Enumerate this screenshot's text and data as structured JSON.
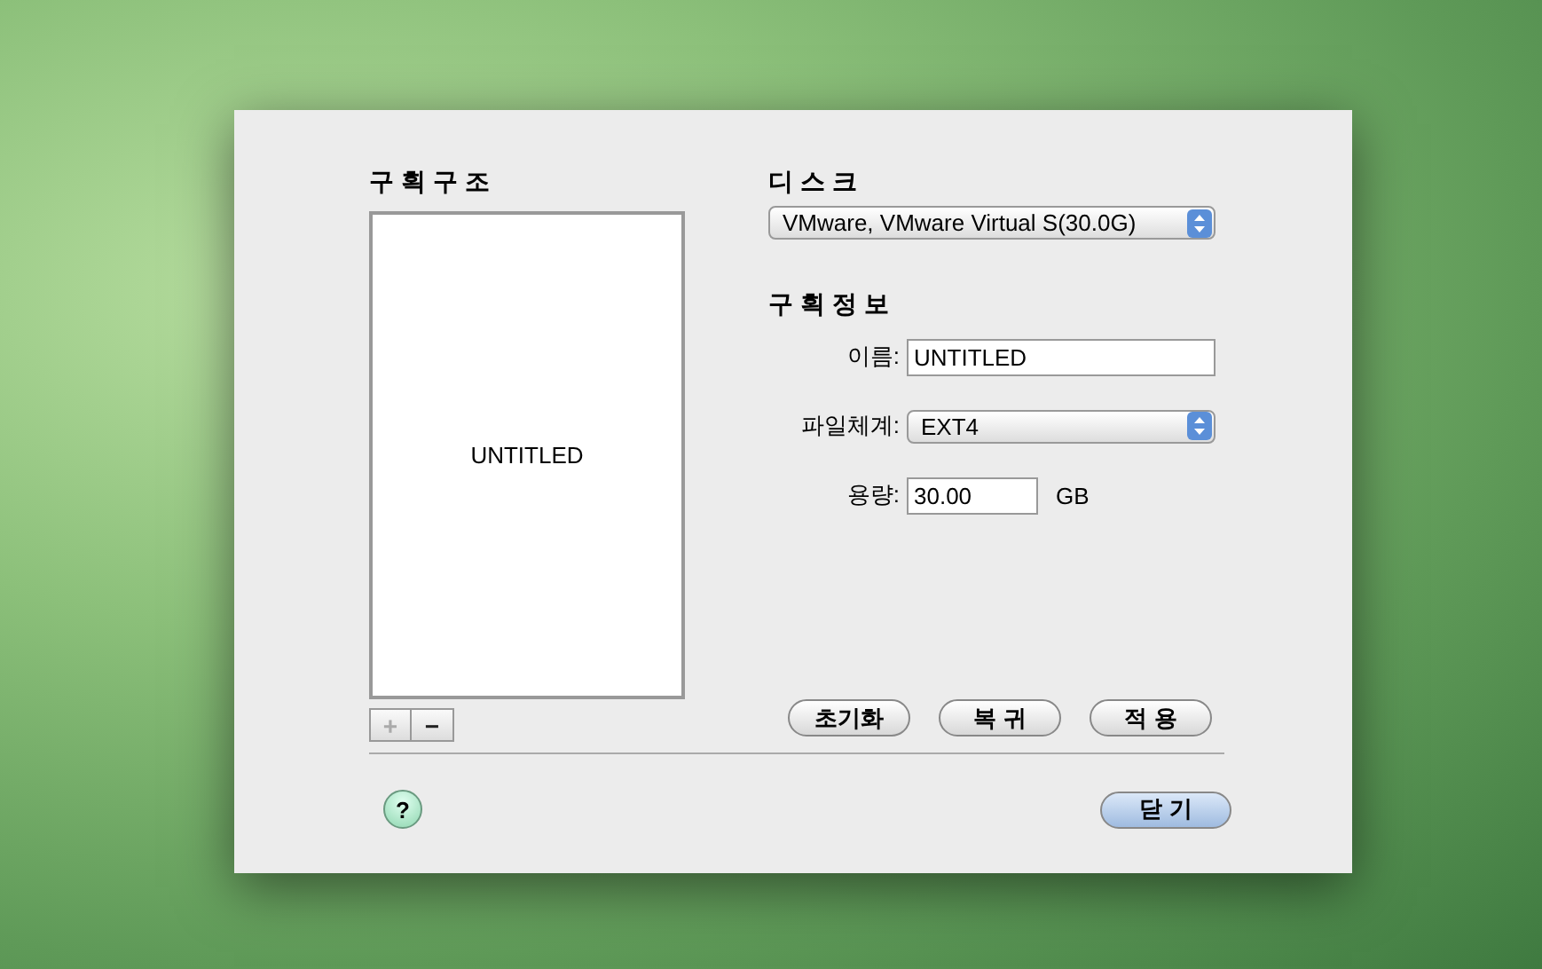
{
  "partition_layout": {
    "title": "구획구조",
    "partitions": [
      {
        "name": "UNTITLED",
        "selected": false
      }
    ],
    "add_button": {
      "label": "+",
      "disabled": true
    },
    "remove_button": {
      "label": "−",
      "disabled": false
    }
  },
  "disk": {
    "title": "디스크",
    "value": "VMware, VMware Virtual S(30.0G)"
  },
  "partition_info": {
    "title": "구획정보",
    "fields": [
      {
        "kind": "text",
        "label": "이름:",
        "value": "UNTITLED"
      },
      {
        "kind": "select",
        "label": "파일체계:",
        "value": "EXT4"
      },
      {
        "kind": "number",
        "label": "용량:",
        "value": "30.00",
        "unit": "GB"
      }
    ],
    "buttons": [
      "초기화",
      "복 귀",
      "적 용"
    ]
  },
  "help_button": {
    "label": "?"
  },
  "close_button": {
    "label": "닫 기"
  }
}
